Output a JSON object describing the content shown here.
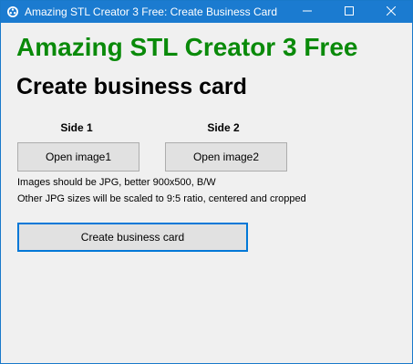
{
  "window": {
    "title": "Amazing STL Creator 3 Free: Create Business Card",
    "controls": {
      "minimize_icon": "minimize-icon",
      "maximize_icon": "maximize-icon",
      "close_icon": "close-icon"
    }
  },
  "main": {
    "heading": "Amazing STL Creator 3 Free",
    "subheading": "Create business card",
    "side1_label": "Side 1",
    "side2_label": "Side 2",
    "open_image1_label": "Open image1",
    "open_image2_label": "Open image2",
    "info_line1": "Images should be JPG, better 900x500, B/W",
    "info_line2": "Other JPG sizes will be scaled to 9:5 ratio, centered and cropped",
    "create_button_label": "Create business card"
  },
  "colors": {
    "titlebar": "#1b7bd0",
    "heading": "#0a8a0a",
    "focus_border": "#0078d7"
  }
}
